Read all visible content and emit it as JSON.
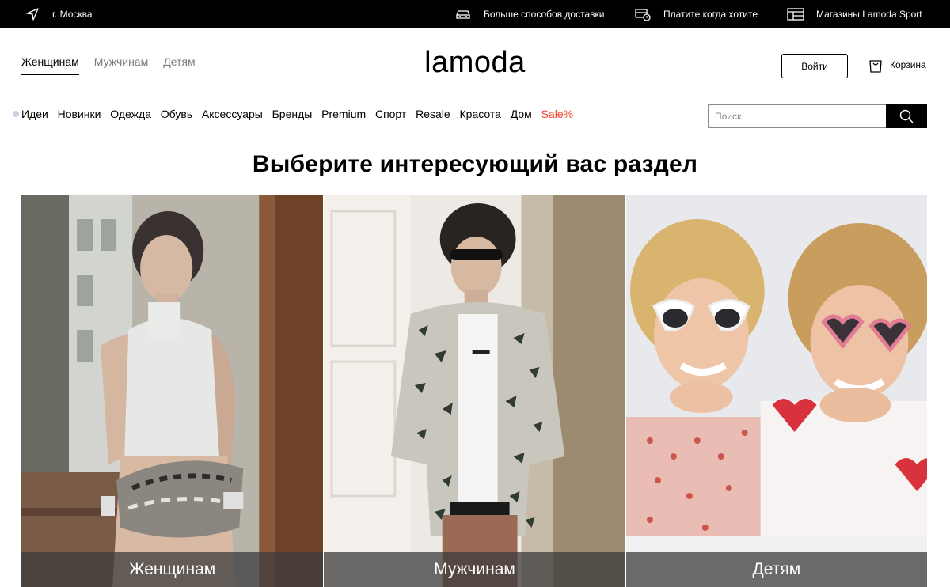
{
  "topbar": {
    "location": "г. Москва",
    "location_icon": "location-arrow-icon",
    "promos": [
      {
        "label": "Больше способов доставки",
        "icon": "delivery-car-icon"
      },
      {
        "label": "Платите когда хотите",
        "icon": "payment-icon"
      },
      {
        "label": "Магазины Lamoda Sport",
        "icon": "store-icon"
      }
    ]
  },
  "header": {
    "gender_tabs": [
      "Женщинам",
      "Мужчинам",
      "Детям"
    ],
    "active_tab": "Женщинам",
    "logo": "lamoda",
    "login_label": "Войти",
    "cart_label": "Корзина"
  },
  "categories": [
    "Идеи",
    "Новинки",
    "Одежда",
    "Обувь",
    "Аксессуары",
    "Бренды",
    "Premium",
    "Спорт",
    "Resale",
    "Красота",
    "Дом",
    "Sale%"
  ],
  "search": {
    "placeholder": "Поиск"
  },
  "page": {
    "heading": "Выберите интересующий вас раздел"
  },
  "sections": [
    {
      "label": "Женщинам"
    },
    {
      "label": "Мужчинам"
    },
    {
      "label": "Детям"
    }
  ],
  "colors": {
    "sale": "#f0412a",
    "topbar_bg": "#000000"
  }
}
